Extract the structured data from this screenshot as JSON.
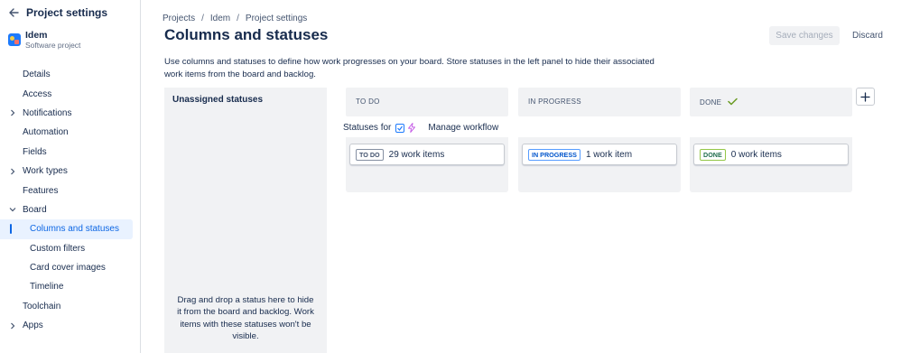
{
  "sidebar": {
    "back_title": "Project settings",
    "project": {
      "name": "Idem",
      "type": "Software project"
    },
    "items": [
      {
        "label": "Details",
        "chevron": false,
        "child": false,
        "active": false
      },
      {
        "label": "Access",
        "chevron": false,
        "child": false,
        "active": false
      },
      {
        "label": "Notifications",
        "chevron": true,
        "child": false,
        "active": false
      },
      {
        "label": "Automation",
        "chevron": false,
        "child": false,
        "active": false
      },
      {
        "label": "Fields",
        "chevron": false,
        "child": false,
        "active": false
      },
      {
        "label": "Work types",
        "chevron": true,
        "child": false,
        "active": false
      },
      {
        "label": "Features",
        "chevron": false,
        "child": false,
        "active": false
      },
      {
        "label": "Board",
        "chevron": true,
        "expanded": true,
        "child": false,
        "active": false
      },
      {
        "label": "Columns and statuses",
        "chevron": false,
        "child": true,
        "active": true
      },
      {
        "label": "Custom filters",
        "chevron": false,
        "child": true,
        "active": false
      },
      {
        "label": "Card cover images",
        "chevron": false,
        "child": true,
        "active": false
      },
      {
        "label": "Timeline",
        "chevron": false,
        "child": true,
        "active": false
      },
      {
        "label": "Toolchain",
        "chevron": false,
        "child": false,
        "active": false
      },
      {
        "label": "Apps",
        "chevron": true,
        "child": false,
        "active": false
      }
    ]
  },
  "breadcrumb": [
    "Projects",
    "Idem",
    "Project settings"
  ],
  "page": {
    "title": "Columns and statuses",
    "save_label": "Save changes",
    "discard_label": "Discard",
    "description": "Use columns and statuses to define how work progresses on your board. Store statuses in the left panel to hide their associated work items from the board and backlog."
  },
  "unassigned": {
    "title": "Unassigned statuses",
    "hint": "Drag and drop a status here to hide it from the board and backlog. Work items with these statuses won't be visible."
  },
  "statuses_row": {
    "label": "Statuses for",
    "manage_label": "Manage workflow"
  },
  "columns": [
    {
      "name": "TO DO",
      "status": "TO DO",
      "count_text": "29 work items",
      "check": false
    },
    {
      "name": "IN PROGRESS",
      "status": "IN PROGRESS",
      "count_text": "1 work item",
      "check": false
    },
    {
      "name": "DONE",
      "status": "DONE",
      "count_text": "0 work items",
      "check": true
    }
  ],
  "colors": {
    "accent": "#0c66e4",
    "active_bg": "#e9f2ff",
    "panel_bg": "#f1f2f4",
    "done_green": "#5b7f24"
  }
}
